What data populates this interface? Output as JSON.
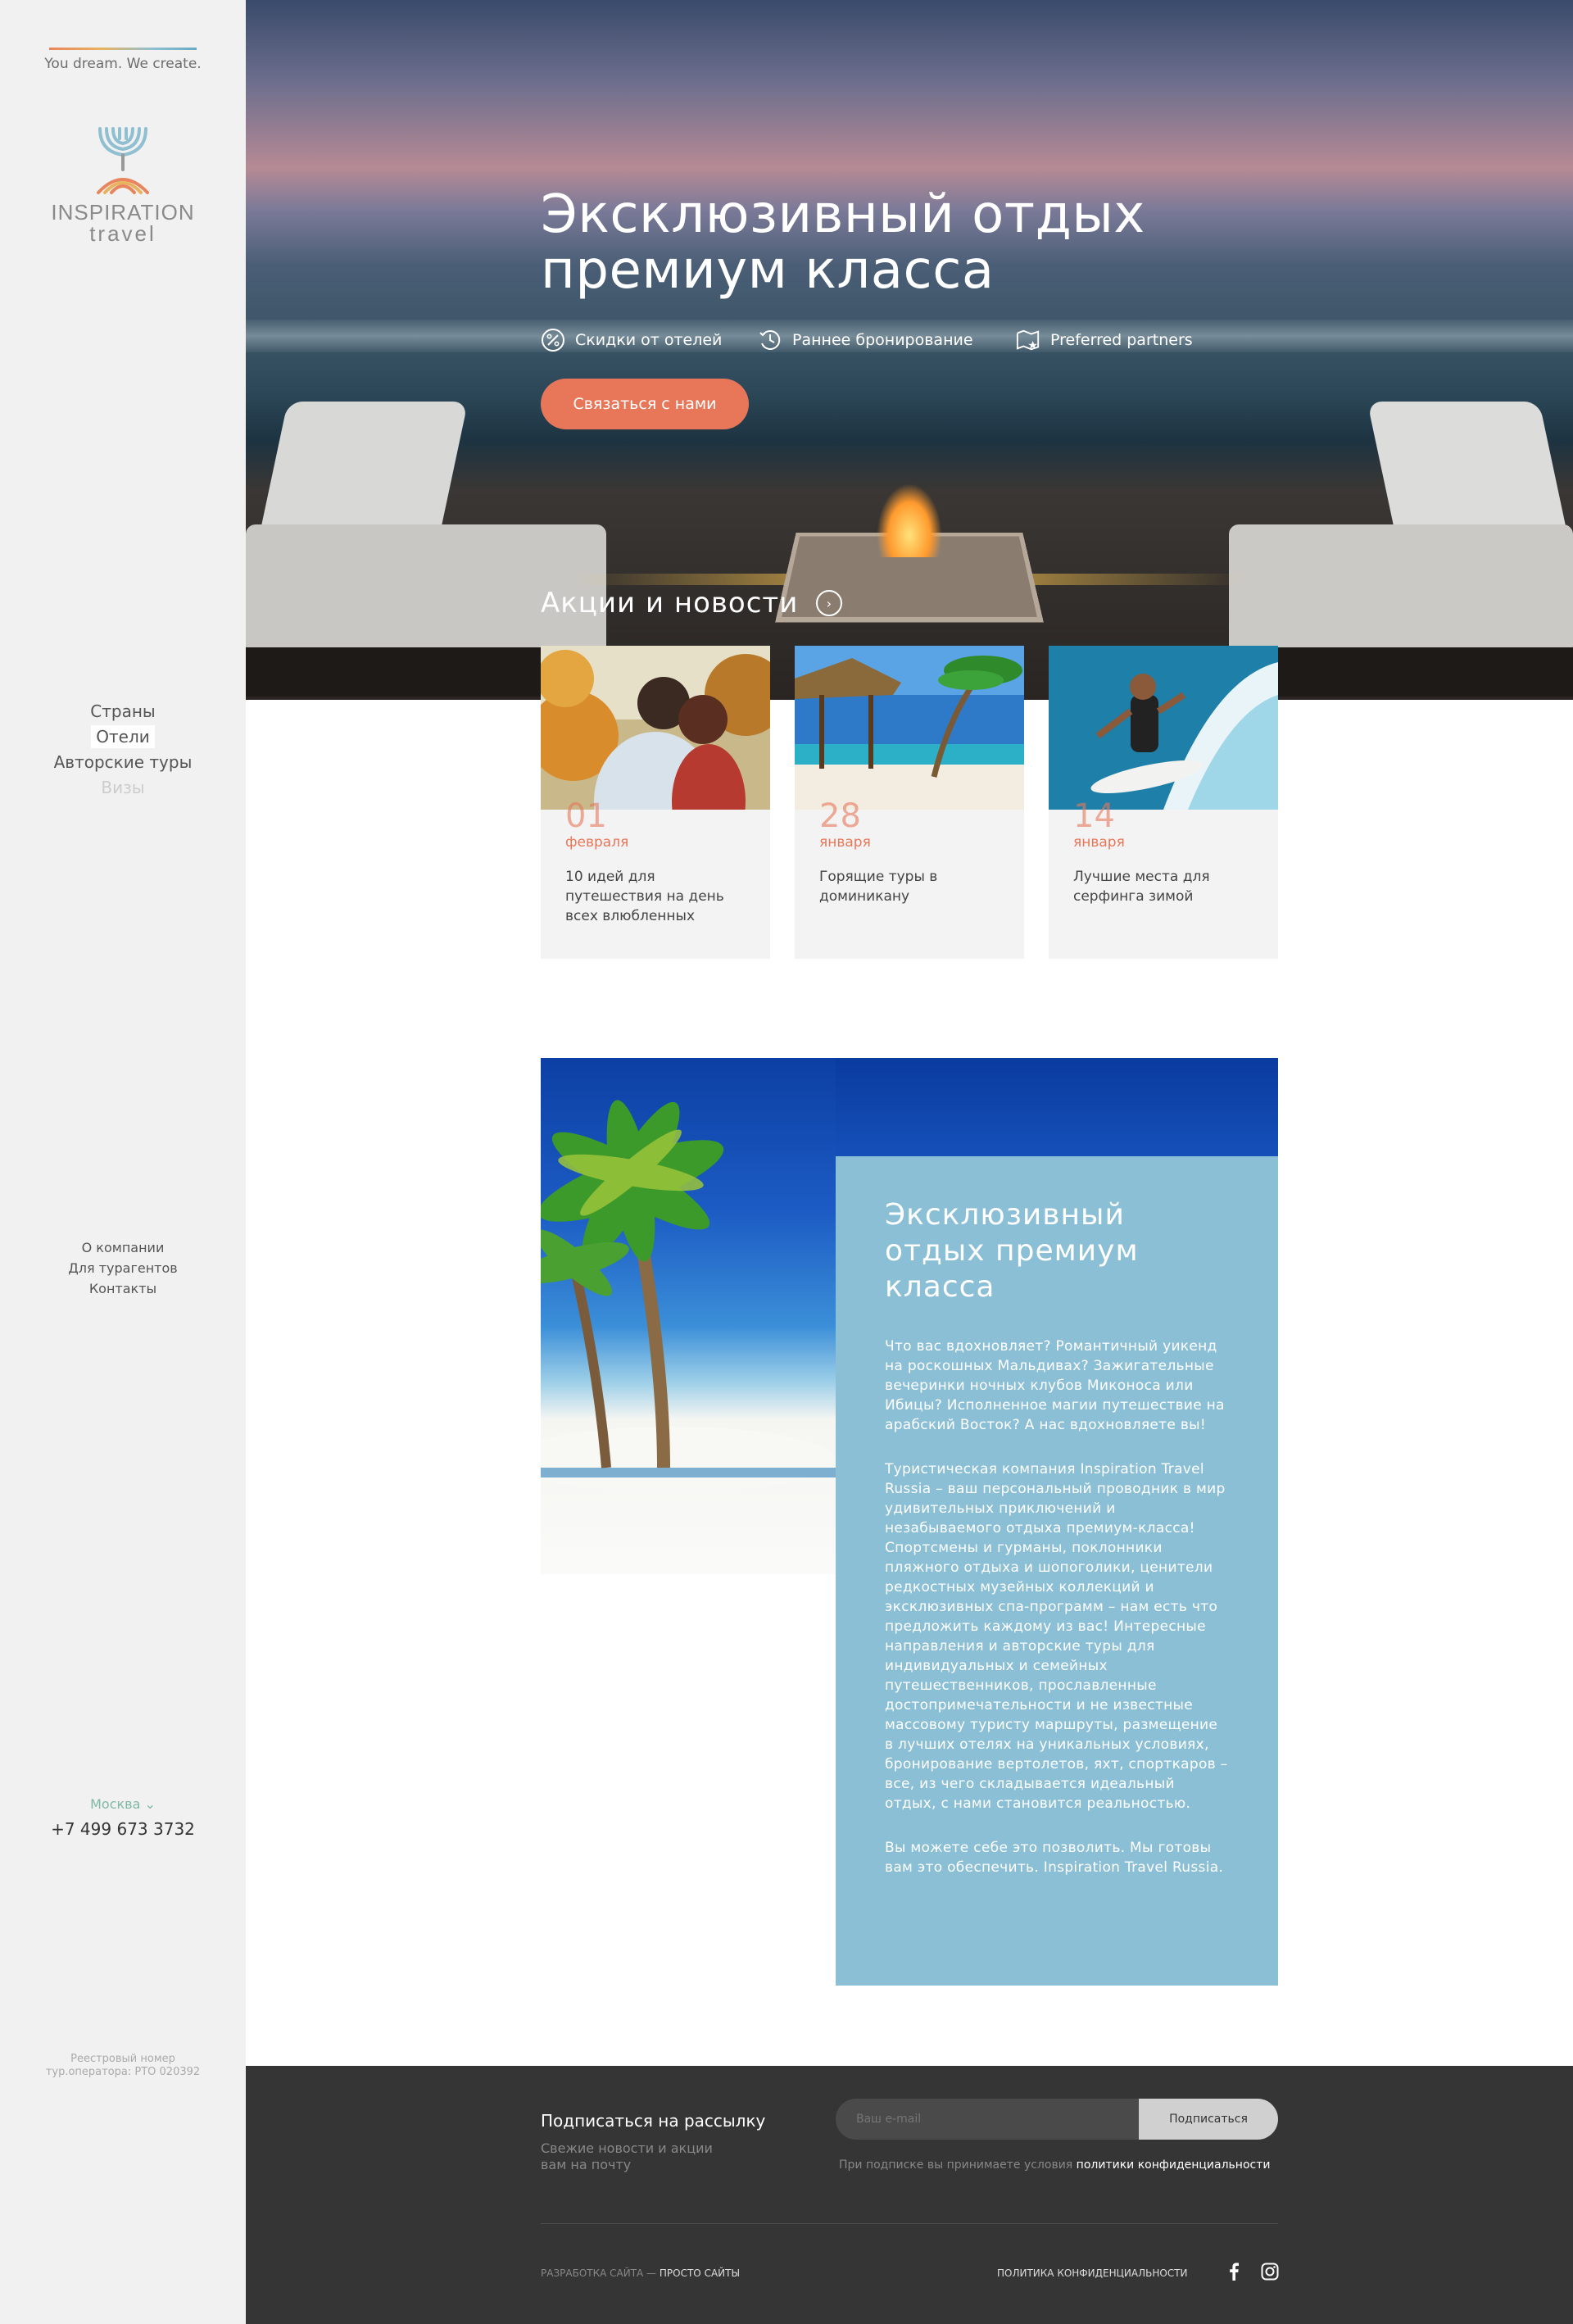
{
  "sidebar": {
    "tagline": "You dream. We create.",
    "logo_line1": "INSPIRATION",
    "logo_line2": "travel",
    "nav_main": [
      "Страны",
      "Отели",
      "Авторские туры",
      "Визы"
    ],
    "nav_secondary": [
      "О компании",
      "Для турагентов",
      "Контакты"
    ],
    "city": "Москва",
    "phone": "+7 499 673 3732",
    "registry_line1": "Реестровый номер",
    "registry_line2": "тур.оператора: РТО 020392"
  },
  "hero": {
    "title_line1": "Эксклюзивный отдых",
    "title_line2": "премиум класса",
    "features": [
      {
        "icon": "percent-icon",
        "label": "Скидки от отелей"
      },
      {
        "icon": "clock-icon",
        "label": "Раннее бронирование"
      },
      {
        "icon": "map-star-icon",
        "label": "Preferred partners"
      }
    ],
    "cta_label": "Связаться с нами"
  },
  "news": {
    "title": "Акции и новости",
    "items": [
      {
        "day": "01",
        "month": "февраля",
        "text": "10 идей для путешествия на день всех влюбленных"
      },
      {
        "day": "28",
        "month": "января",
        "text": "Горящие туры в доминикану"
      },
      {
        "day": "14",
        "month": "января",
        "text": "Лучшие места для серфинга зимой"
      }
    ]
  },
  "about": {
    "title": "Эксклюзивный отдых премиум класса",
    "paragraphs": [
      "Что вас вдохновляет? Романтичный уикенд на роскошных Мальдивах? Зажигательные вечеринки ночных клубов Миконоса или Ибицы? Исполненное магии путешествие на арабский Восток? А нас вдохновляете вы!",
      "Туристическая компания Inspiration Travel Russia – ваш персональный проводник в мир удивительных приключений и незабываемого отдыха премиум-класса! Спортсмены и гурманы, поклонники пляжного отдыха и шопоголики, ценители редкостных музейных коллекций и эксклюзивных спа-программ – нам есть что предложить каждому из вас! Интересные направления и авторские туры для индивидуальных и семейных путешественников, прославленные достопримечательности и не известные массовому туристу маршруты, размещение в лучших отелях на уникальных условиях, бронирование вертолетов, яхт, спорткаров – все, из чего складывается идеальный отдых, с нами становится реальностью.",
      "Вы можете себе это позволить. Мы готовы вам это обеспечить. Inspiration Travel Russia."
    ]
  },
  "footer": {
    "subscribe_title": "Подписаться на рассылку",
    "subscribe_sub": "Свежие новости и акции вам на почту",
    "email_placeholder": "Ваш e-mail",
    "subscribe_button": "Подписаться",
    "privacy_note": "При подписке вы принимаете условия",
    "privacy_link": "политики конфиденциальности",
    "dev_prefix": "РАЗРАБОТКА САЙТА —",
    "dev_link": "ПРОСТО САЙТЫ",
    "policy_link": "ПОЛИТИКА КОНФИДЕНЦИАЛЬНОСТИ",
    "social": [
      "facebook-icon",
      "instagram-icon"
    ]
  },
  "colors": {
    "accent": "#e8775a",
    "about_bg": "#8bbfd6",
    "footer_bg": "#353535",
    "sidebar_bg": "#f1f1f1"
  }
}
